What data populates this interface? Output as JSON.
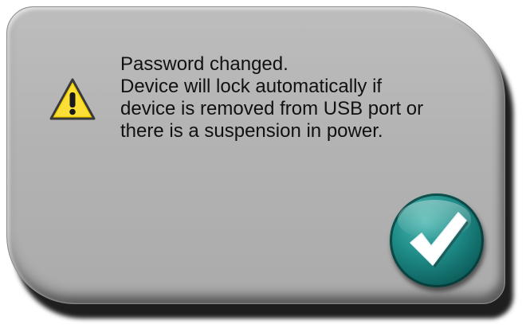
{
  "dialog": {
    "message_lines": [
      "Password changed.",
      "Device will lock automatically if",
      "device is removed from USB port or",
      "there is a suspension in power."
    ]
  },
  "icons": {
    "warning": "warning-icon",
    "confirm": "check-icon"
  },
  "colors": {
    "panel": "#b3b3b3",
    "button": "#1f8c88",
    "warning": "#f5d000"
  }
}
